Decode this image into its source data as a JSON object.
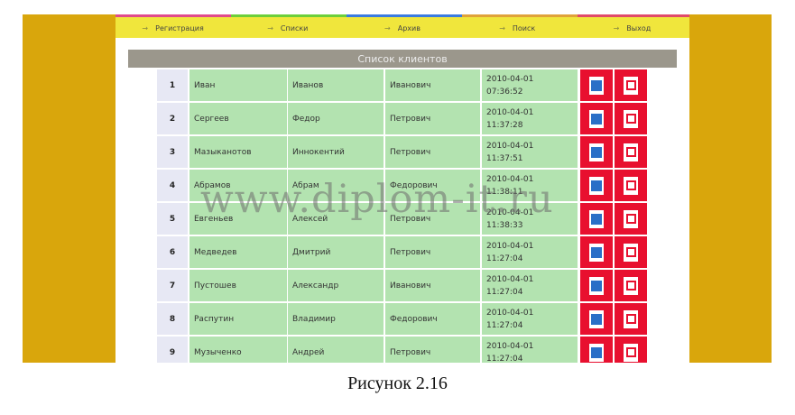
{
  "nav": [
    "Регистрация",
    "Списки",
    "Архив",
    "Поиск",
    "Выход"
  ],
  "list_title": "Список клиентов",
  "rows": [
    {
      "n": "1",
      "last": "Иван",
      "first": "Иванов",
      "middle": "Иванович",
      "date": "2010-04-01",
      "time": "07:36:52"
    },
    {
      "n": "2",
      "last": "Сергеев",
      "first": "Федор",
      "middle": "Петрович",
      "date": "2010-04-01",
      "time": "11:37:28"
    },
    {
      "n": "3",
      "last": "Мазыканотов",
      "first": "Иннокентий",
      "middle": "Петрович",
      "date": "2010-04-01",
      "time": "11:37:51"
    },
    {
      "n": "4",
      "last": "Абрамов",
      "first": "Абрам",
      "middle": "Федорович",
      "date": "2010-04-01",
      "time": "11:38:11"
    },
    {
      "n": "5",
      "last": "Евгеньев",
      "first": "Алексей",
      "middle": "Петрович",
      "date": "2010-04-01",
      "time": "11:38:33"
    },
    {
      "n": "6",
      "last": "Медведев",
      "first": "Дмитрий",
      "middle": "Петрович",
      "date": "2010-04-01",
      "time": "11:27:04"
    },
    {
      "n": "7",
      "last": "Пустошев",
      "first": "Александр",
      "middle": "Иванович",
      "date": "2010-04-01",
      "time": "11:27:04"
    },
    {
      "n": "8",
      "last": "Распутин",
      "first": "Владимир",
      "middle": "Федорович",
      "date": "2010-04-01",
      "time": "11:27:04"
    },
    {
      "n": "9",
      "last": "Музыченко",
      "first": "Андрей",
      "middle": "Петрович",
      "date": "2010-04-01",
      "time": "11:27:04"
    }
  ],
  "icons": {
    "edit": "edit-icon",
    "delete": "delete-icon"
  },
  "colors": {
    "frame": "#d9a60c",
    "navbar": "#f0e63c",
    "row": "#b3e3b0",
    "index": "#e7e8f4",
    "action": "#e8102f"
  },
  "watermark": "www.diplom-it.ru",
  "caption": "Рисунок 2.16"
}
